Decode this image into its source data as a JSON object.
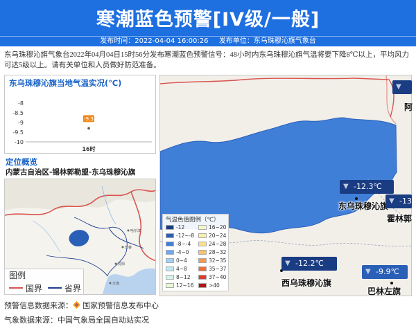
{
  "banner": {
    "title": "寒潮蓝色预警[IV级/一般]",
    "publish_time_label": "发布时间：2022-04-04 16:00:26",
    "publisher_label": "发布单位：东乌珠穆沁旗气象台"
  },
  "description": "东乌珠穆沁旗气象台2022年04月04日15时56分发布寒潮蓝色预警信号：48小时内东乌珠穆沁旗气温将要下降8℃以上，平均风力可达5级以上。请有关单位和人员做好防范准备。",
  "temp_panel": {
    "title": "东乌珠穆沁旗当地气温实况(℃)",
    "chart_data": {
      "type": "scatter",
      "categories": [
        "16时"
      ],
      "values": [
        -9.3
      ],
      "data_labels": [
        "-9.3"
      ],
      "yticks": [
        "-8",
        "-8.5",
        "-9",
        "-9.5",
        "-10"
      ],
      "ylim": [
        -10,
        -8
      ],
      "title": "东乌珠穆沁旗当地气温实况(℃)"
    },
    "marker_color": "#f08a1c"
  },
  "location": {
    "title": "定位概览",
    "text": "内蒙古自治区-锡林郭勒盟-东乌珠穆沁旗"
  },
  "minimap": {
    "legend_title": "图例",
    "legend_items": [
      {
        "label": "国界",
        "color": "#d9534f"
      },
      {
        "label": "省界",
        "color": "#1e3d8f"
      }
    ],
    "cities": [
      "哈尔滨",
      "长春",
      "沈阳",
      "大连"
    ]
  },
  "temp_legend": {
    "title": "气温色值图例（℃）",
    "items": [
      {
        "label": "-12",
        "color": "#1a3c82"
      },
      {
        "label": "-12~-8",
        "color": "#2a5fb8"
      },
      {
        "label": "-8~-4",
        "color": "#3f7fd8"
      },
      {
        "label": "-4~0",
        "color": "#6fa8ec"
      },
      {
        "label": "0~4",
        "color": "#a3d0f5"
      },
      {
        "label": "4~8",
        "color": "#bfe6f2"
      },
      {
        "label": "8~12",
        "color": "#d6f2e8"
      },
      {
        "label": "12~16",
        "color": "#eaf7d6"
      },
      {
        "label": "16~20",
        "color": "#f5f7c8"
      },
      {
        "label": "20~24",
        "color": "#f6f0a8"
      },
      {
        "label": "24~28",
        "color": "#f9e08a"
      },
      {
        "label": "28~32",
        "color": "#f8c26a"
      },
      {
        "label": "32~35",
        "color": "#f59a4e"
      },
      {
        "label": "35~37",
        "color": "#ee6e3a"
      },
      {
        "label": "37~40",
        "color": "#dc3b2a"
      },
      {
        "label": ">40",
        "color": "#b31414"
      }
    ]
  },
  "stations": [
    {
      "name": "东乌珠穆沁旗",
      "temp": "-12.3℃"
    },
    {
      "name": "西乌珠穆沁旗",
      "temp": "-12.2℃"
    },
    {
      "name": "巴林左旗",
      "temp": "-9.9℃"
    },
    {
      "name": "霍林郭",
      "temp": "-13"
    },
    {
      "name": "阿",
      "temp": ""
    }
  ],
  "footer": {
    "source_label": "预警信息数据来源：",
    "source_value": "国家预警信息发布中心",
    "weather_label": "气象数据来源：中国气象局全国自动站实况"
  }
}
